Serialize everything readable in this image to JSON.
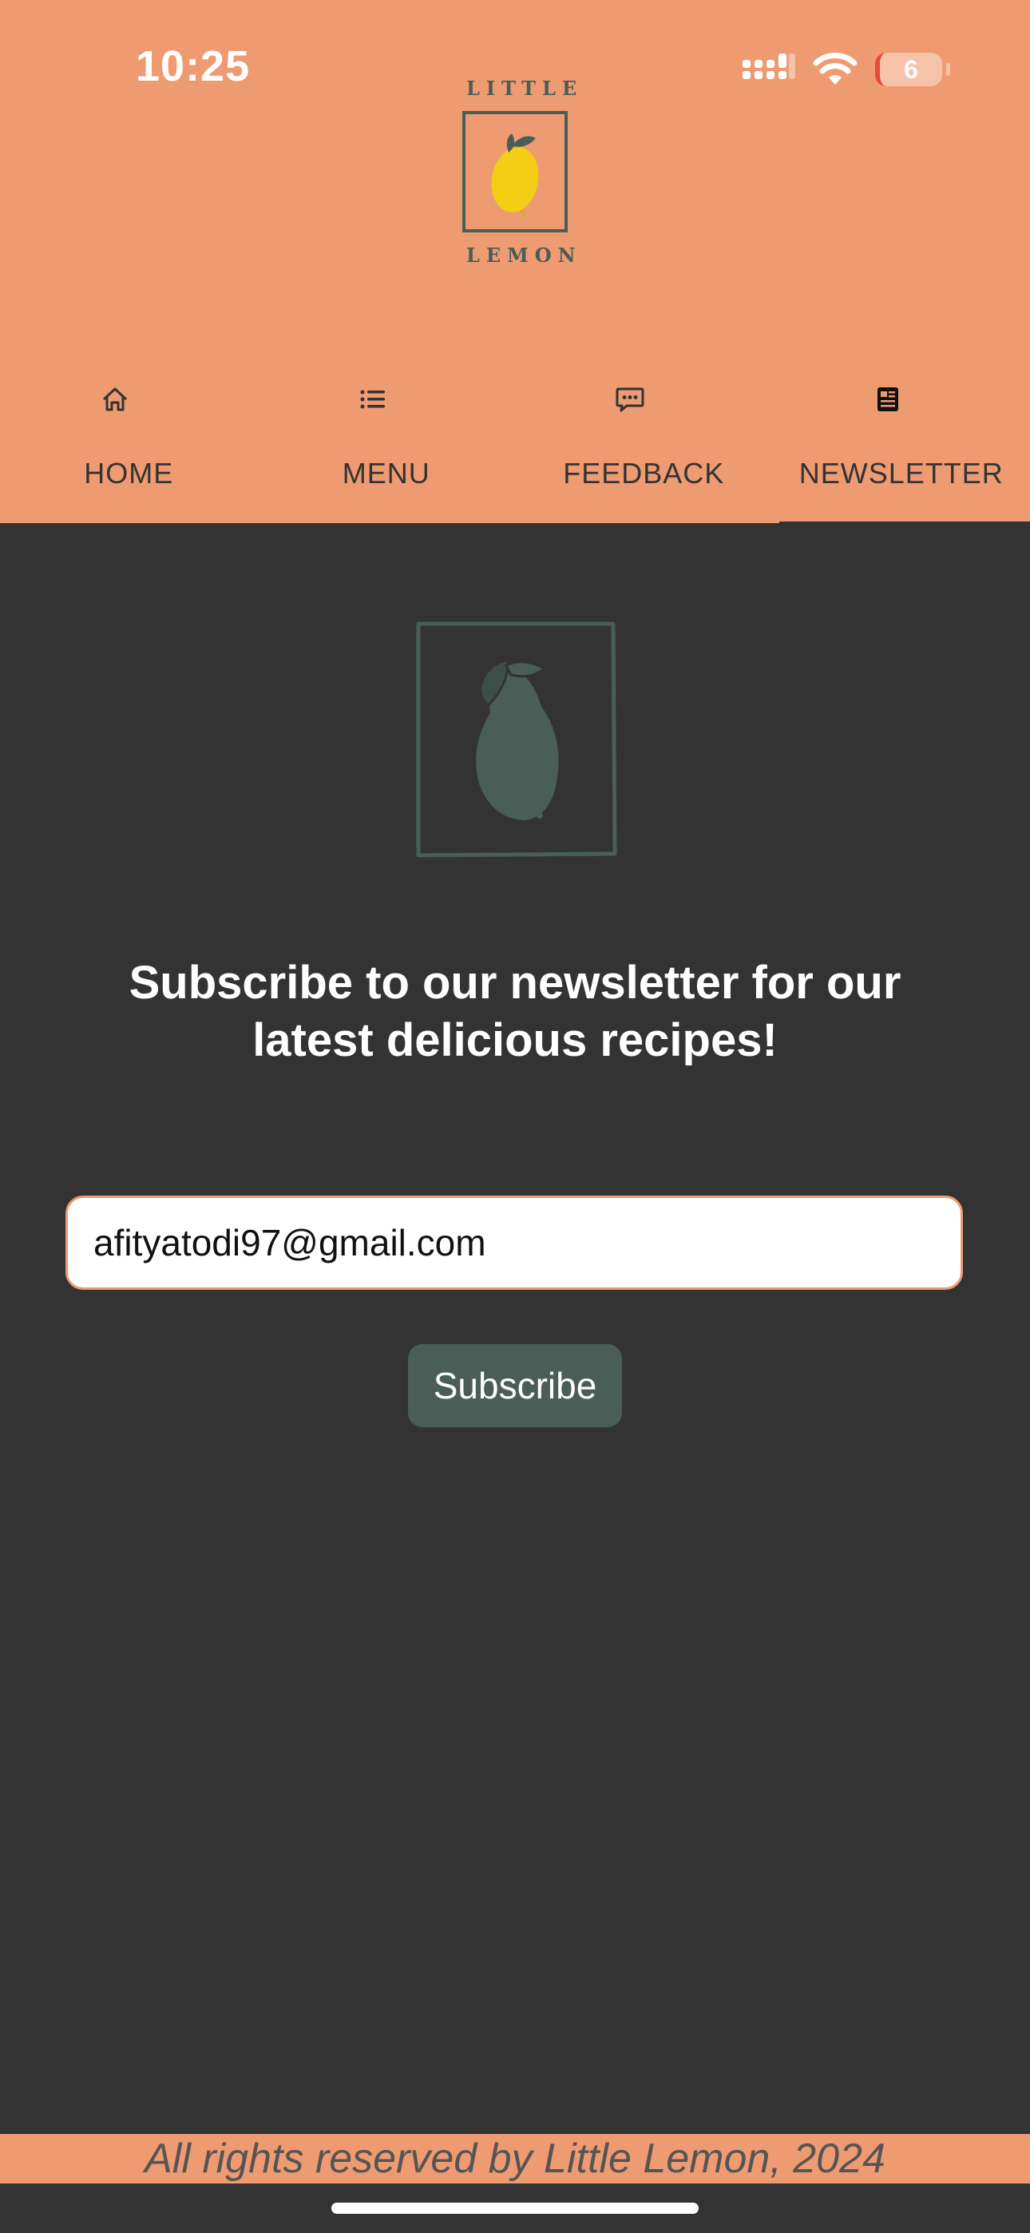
{
  "status_bar": {
    "time": "10:25",
    "battery": "6",
    "icons": [
      "cellular-signal-icon",
      "wifi-icon",
      "battery-icon"
    ]
  },
  "logo": {
    "top_word": "LITTLE",
    "bottom_word": "LEMON"
  },
  "tabs": [
    {
      "label": "HOME",
      "icon": "home-icon",
      "active": false
    },
    {
      "label": "MENU",
      "icon": "list-icon",
      "active": false
    },
    {
      "label": "FEEDBACK",
      "icon": "chat-bubble-icon",
      "active": false
    },
    {
      "label": "NEWSLETTER",
      "icon": "newspaper-icon",
      "active": true
    }
  ],
  "main": {
    "headline": "Subscribe to our newsletter for our latest delicious recipes!",
    "email_value": "afityatodi97@gmail.com",
    "subscribe_label": "Subscribe"
  },
  "footer": {
    "text": "All rights reserved by Little Lemon, 2024"
  },
  "colors": {
    "header": "#EF9B72",
    "background": "#333333",
    "accent_green": "#495E57",
    "lemon_yellow": "#F4CE14"
  }
}
